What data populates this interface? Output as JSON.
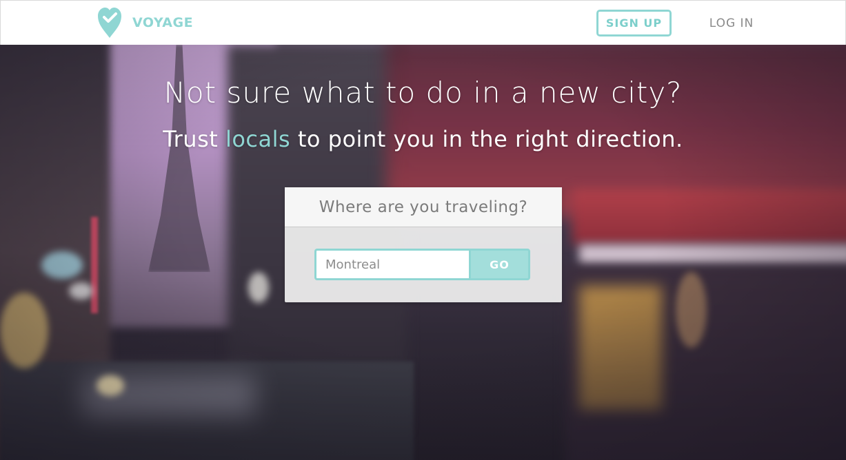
{
  "header": {
    "brand_name": "VOYAGE",
    "logo_icon": "heart-check-pin-icon",
    "signup_label": "SIGN UP",
    "login_label": "LOG IN"
  },
  "hero": {
    "headline": "Not sure what to do in a new city?",
    "subline_before": "Trust ",
    "subline_accent": "locals",
    "subline_after": " to point you in the right direction."
  },
  "search": {
    "title": "Where are you traveling?",
    "value": "Montreal",
    "placeholder": "Montreal",
    "go_label": "GO"
  },
  "colors": {
    "accent": "#8fd6d3",
    "go_fill": "#a3dedb",
    "login_text": "#8a8a8a"
  }
}
